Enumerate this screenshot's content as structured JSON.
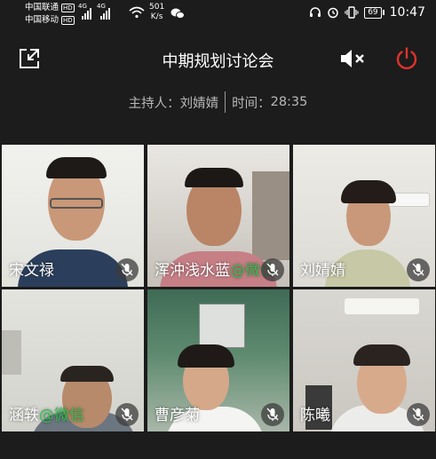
{
  "status_bar": {
    "carrier1": "中国联通",
    "carrier2": "中国移动",
    "hd": "HD",
    "gen1": "4G",
    "gen2": "4G",
    "speed_value": "501",
    "speed_unit": "K/s",
    "battery": "69",
    "time": "10:47"
  },
  "header": {
    "title": "中期规划讨论会"
  },
  "meeting_info": {
    "host_label": "主持人：",
    "host_name": "刘婧婧",
    "time_label": "时间：",
    "time_value": "28:35"
  },
  "participants": [
    {
      "name": "宋文禄",
      "suffix": "",
      "muted": true
    },
    {
      "name": "浑沖浅水蓝",
      "suffix": "@微信",
      "muted": true
    },
    {
      "name": "刘婧婧",
      "suffix": "",
      "muted": true
    },
    {
      "name": "涵轶",
      "suffix": "@微信",
      "muted": true
    },
    {
      "name": "曹彦菊",
      "suffix": "",
      "muted": true
    },
    {
      "name": "陈曦",
      "suffix": "",
      "muted": true
    }
  ],
  "colors": {
    "background": "#1c1c1c",
    "power": "#e0332b",
    "wechat_green": "#2fbf4f"
  },
  "icons": [
    "shrink-window-icon",
    "speaker-muted-icon",
    "power-icon",
    "mic-muted-icon",
    "wifi-icon",
    "wechat-icon",
    "headset-icon",
    "alarm-icon",
    "vibrate-icon"
  ]
}
